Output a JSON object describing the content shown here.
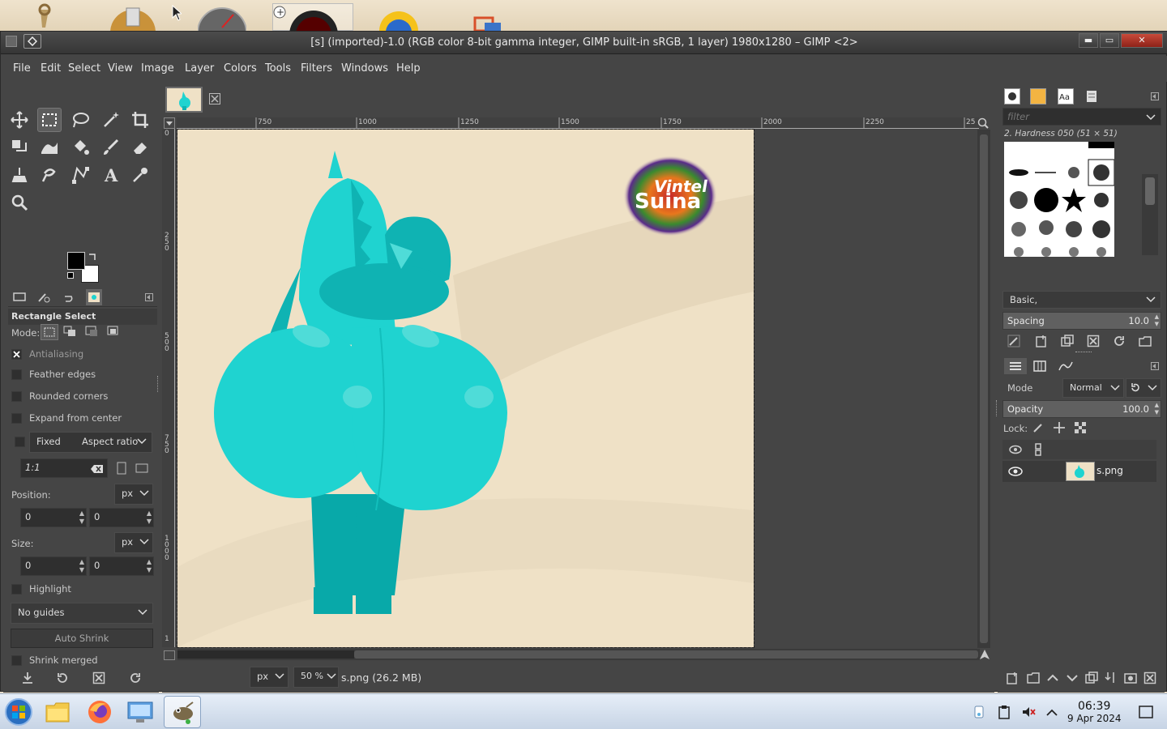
{
  "window": {
    "title": "[s] (imported)-1.0 (RGB color 8-bit gamma integer, GIMP built-in sRGB, 1 layer) 1980x1280 – GIMP <2>",
    "minimize": "▬",
    "maximize": "▭",
    "close": "✕"
  },
  "menu": [
    "File",
    "Edit",
    "Select",
    "View",
    "Image",
    "Layer",
    "Colors",
    "Tools",
    "Filters",
    "Windows",
    "Help"
  ],
  "tool_options": {
    "title": "Rectangle Select",
    "mode_label": "Mode:",
    "antialiasing": "Antialiasing",
    "feather_edges": "Feather edges",
    "rounded_corners": "Rounded corners",
    "expand_from_center": "Expand from center",
    "fixed": "Fixed",
    "aspect_ratio": "Aspect ratio",
    "ratio_value": "1:1",
    "position_label": "Position:",
    "size_label": "Size:",
    "unit": "px",
    "pos_x": "0",
    "pos_y": "0",
    "size_w": "0",
    "size_h": "0",
    "highlight": "Highlight",
    "guides": "No guides",
    "auto_shrink": "Auto Shrink",
    "shrink_merged": "Shrink merged"
  },
  "ruler": {
    "h_labels": [
      "750",
      "1000",
      "1250",
      "1500",
      "1750",
      "2000",
      "2250",
      "25"
    ],
    "v_labels": [
      "0",
      "250",
      "500",
      "750",
      "1000",
      "1"
    ]
  },
  "canvas": {
    "logo_line1": "Vintel",
    "logo_line2": "Suina",
    "character_color": "#1fd3d0",
    "background_color": "#efe1c6"
  },
  "status": {
    "unit": "px",
    "zoom": "50 %",
    "file_info": "s.png (26.2 MB)"
  },
  "brushes": {
    "filter_placeholder": "filter",
    "brush_name": "2. Hardness 050 (51 × 51)",
    "preset": "Basic,",
    "spacing_label": "Spacing",
    "spacing_value": "10.0"
  },
  "layers": {
    "mode_label": "Mode",
    "mode_value": "Normal",
    "opacity_label": "Opacity",
    "opacity_value": "100.0",
    "lock_label": "Lock:",
    "layer_name": "s.png"
  },
  "taskbar": {
    "time": "06:39",
    "date": "9 Apr 2024"
  }
}
